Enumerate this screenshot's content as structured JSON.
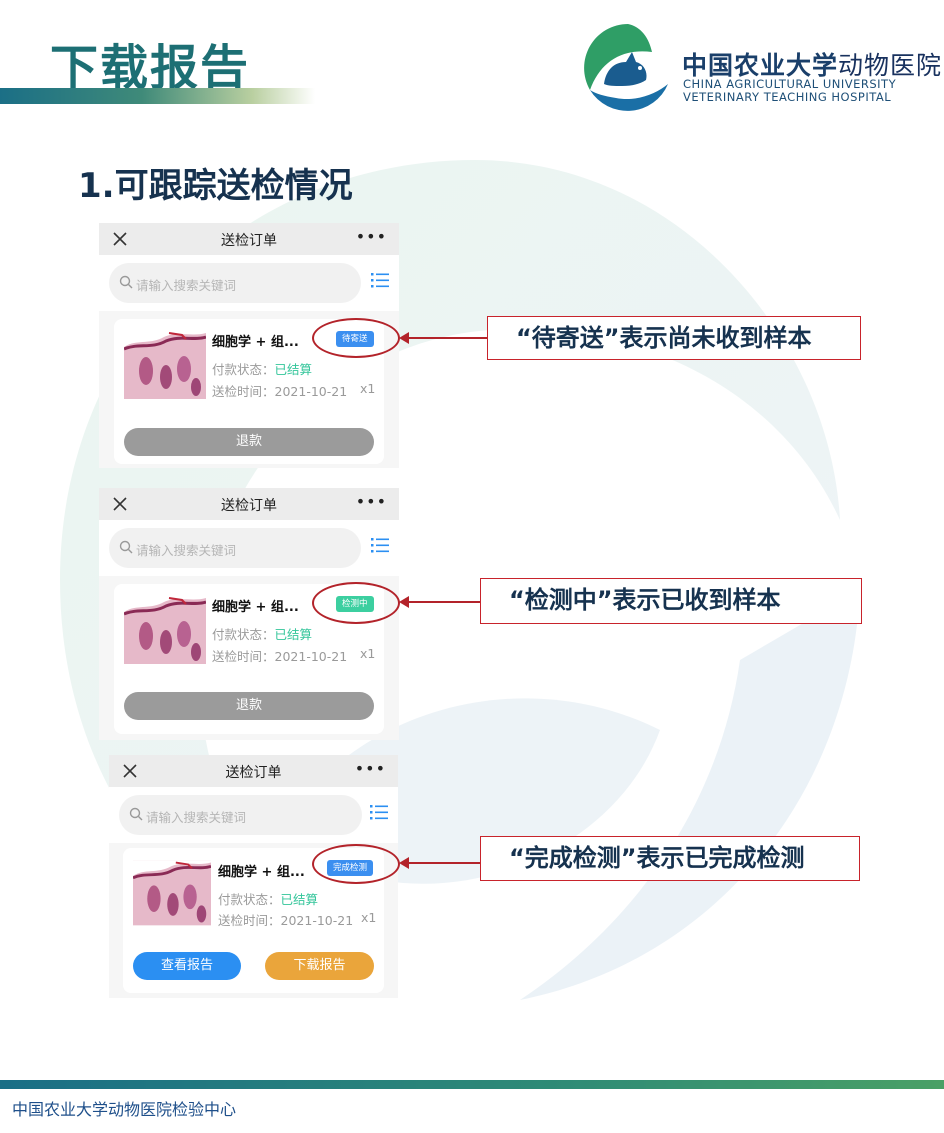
{
  "header": {
    "title": "下载报告",
    "logo_cn_main": "中国农业大学",
    "logo_cn_accent": "动物医院",
    "logo_en_line1": "CHINA AGRICULTURAL UNIVERSITY",
    "logo_en_line2": "VETERINARY TEACHING HOSPITAL"
  },
  "section_title": "1.可跟踪送检情况",
  "panels": [
    {
      "nav_title": "送检订单",
      "search_placeholder": "请输入搜索关键词",
      "item_name": "细胞学 + 组...",
      "status": "待寄送",
      "payment_label": "付款状态：",
      "payment_value": "已结算",
      "date_label": "送检时间：",
      "date_value": "2021-10-21",
      "quantity": "x1",
      "button_refund": "退款"
    },
    {
      "nav_title": "送检订单",
      "search_placeholder": "请输入搜索关键词",
      "item_name": "细胞学 + 组...",
      "status": "检测中",
      "payment_label": "付款状态：",
      "payment_value": "已结算",
      "date_label": "送检时间：",
      "date_value": "2021-10-21",
      "quantity": "x1",
      "button_refund": "退款"
    },
    {
      "nav_title": "送检订单",
      "search_placeholder": "请输入搜索关键词",
      "item_name": "细胞学 + 组...",
      "status": "完成检测",
      "payment_label": "付款状态：",
      "payment_value": "已结算",
      "date_label": "送检时间：",
      "date_value": "2021-10-21",
      "quantity": "x1",
      "button_view": "查看报告",
      "button_download": "下载报告"
    }
  ],
  "callouts": [
    "“待寄送”表示尚未收到样本",
    "“检测中”表示已收到样本",
    "“完成检测”表示已完成检测"
  ],
  "footer": "中国农业大学动物医院检验中心",
  "colors": {
    "title_teal": "#1d6f74",
    "annotation_red": "#b3232a",
    "badge_blue": "#3b8ff0",
    "badge_green": "#3ccfa0",
    "button_gray": "#9b9b9b",
    "button_blue": "#2b8ff2",
    "button_orange": "#eaa53b"
  }
}
